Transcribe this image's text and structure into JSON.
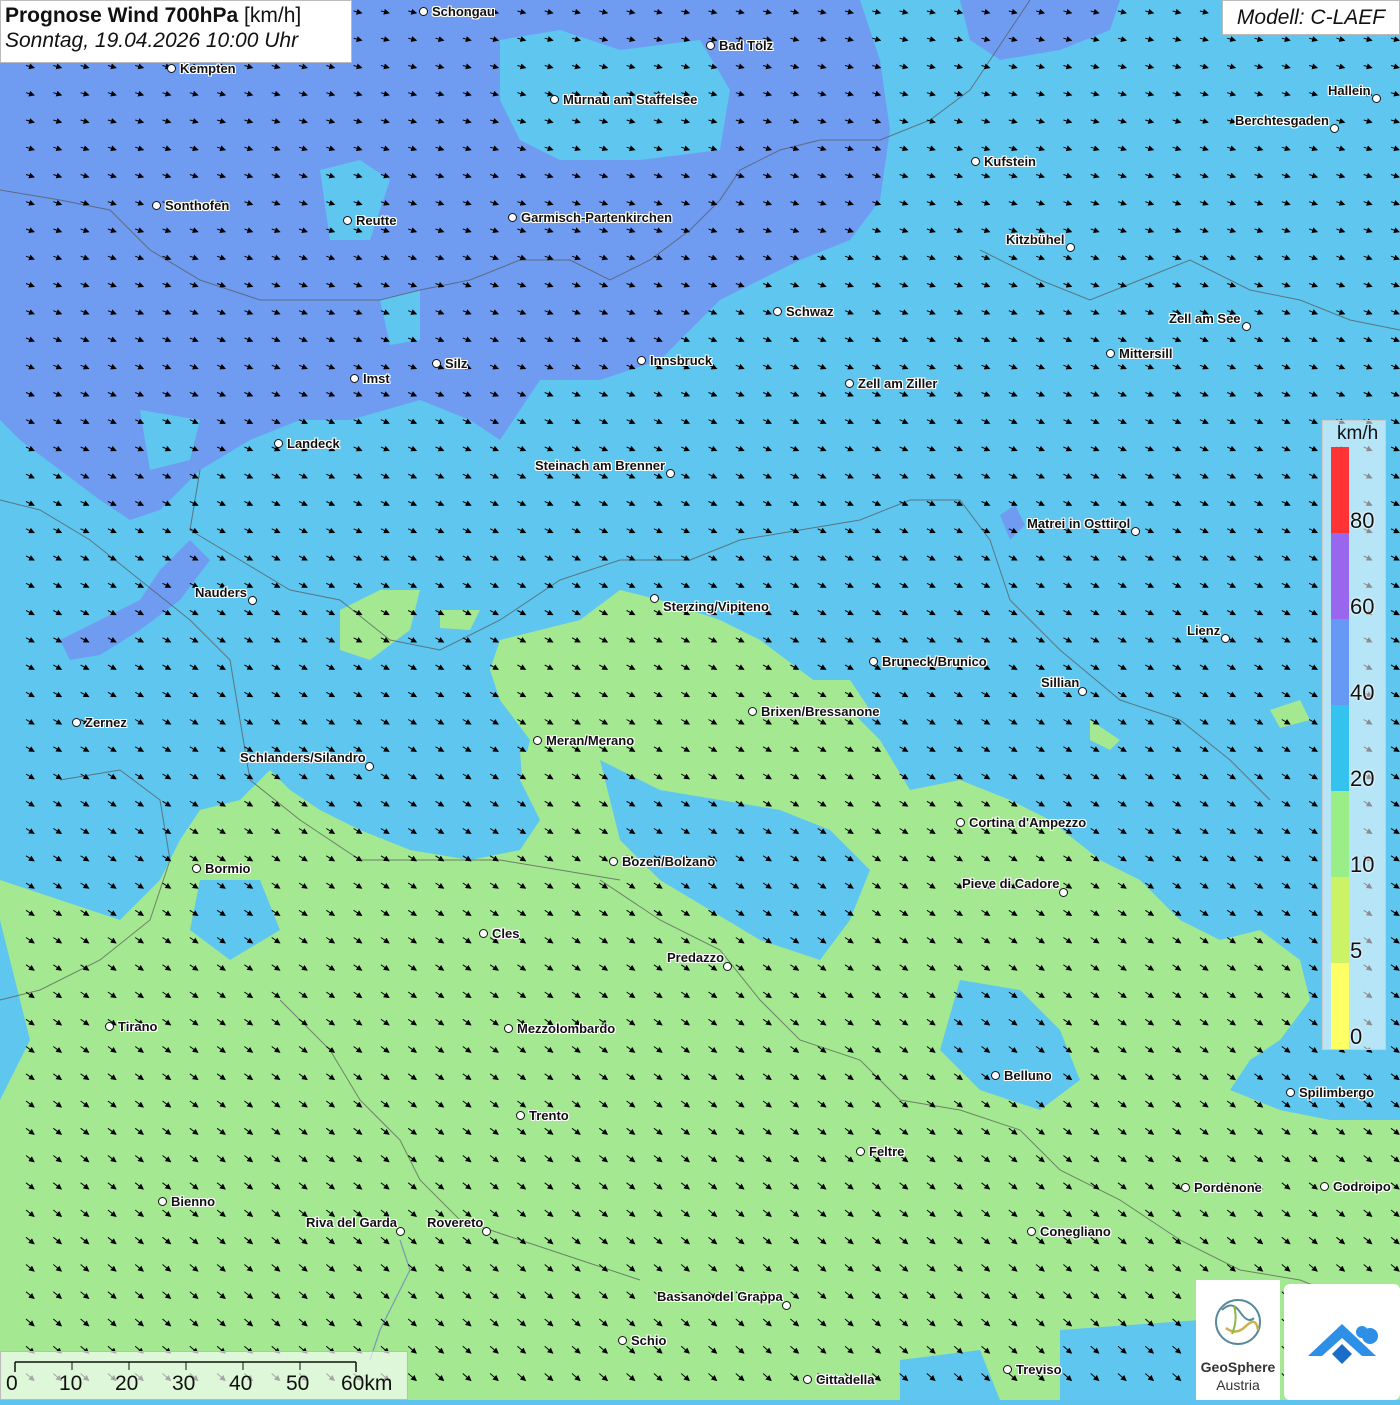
{
  "header": {
    "title_bold": "Prognose Wind 700hPa",
    "title_unit": " [km/h]",
    "datetime": "Sonntag, 19.04.2026 10:00 Uhr",
    "model": "Modell: C-LAEF"
  },
  "legend": {
    "unit": "km/h",
    "stops": [
      {
        "label": "0",
        "color": "#ffff66"
      },
      {
        "label": "5",
        "color": "#ccf266"
      },
      {
        "label": "10",
        "color": "#99ee88"
      },
      {
        "label": "20",
        "color": "#33c3ee"
      },
      {
        "label": "40",
        "color": "#6699f5"
      },
      {
        "label": "60",
        "color": "#9966ee"
      },
      {
        "label": "80",
        "color": "#ff3333"
      }
    ]
  },
  "wind_field": {
    "colors": {
      "calm": "#a4e992",
      "moderate": "#5ec6ef",
      "fresh": "#6f9cf1",
      "strong": "#7e7ef0"
    },
    "predominant_direction": "northwest"
  },
  "scale_bar": {
    "labels": [
      "0",
      "10",
      "20",
      "30",
      "40",
      "50",
      "60km"
    ]
  },
  "cities": [
    {
      "name": "Schongau"
    },
    {
      "name": "Bad Tölz"
    },
    {
      "name": "Kempten"
    },
    {
      "name": "Murnau am Staffelsee"
    },
    {
      "name": "Hallein"
    },
    {
      "name": "Berchtesgaden"
    },
    {
      "name": "Kufstein"
    },
    {
      "name": "Sonthofen"
    },
    {
      "name": "Reutte"
    },
    {
      "name": "Garmisch-Partenkirchen"
    },
    {
      "name": "Kitzbühel"
    },
    {
      "name": "Schwaz"
    },
    {
      "name": "Zell am See"
    },
    {
      "name": "Mittersill"
    },
    {
      "name": "Innsbruck"
    },
    {
      "name": "Silz"
    },
    {
      "name": "Imst"
    },
    {
      "name": "Zell am Ziller"
    },
    {
      "name": "Landeck"
    },
    {
      "name": "Steinach am Brenner"
    },
    {
      "name": "Matrei in Osttirol"
    },
    {
      "name": "Nauders"
    },
    {
      "name": "Sterzing/Vipiteno"
    },
    {
      "name": "Lienz"
    },
    {
      "name": "Bruneck/Brunico"
    },
    {
      "name": "Sillian"
    },
    {
      "name": "Brixen/Bressanone"
    },
    {
      "name": "Zernez"
    },
    {
      "name": "Meran/Merano"
    },
    {
      "name": "Schlanders/Silandro"
    },
    {
      "name": "Cortina d'Ampezzo"
    },
    {
      "name": "Bormio"
    },
    {
      "name": "Bozen/Bolzano"
    },
    {
      "name": "Pieve di Cadore"
    },
    {
      "name": "Cles"
    },
    {
      "name": "Predazzo"
    },
    {
      "name": "Tirano"
    },
    {
      "name": "Mezzolombardo"
    },
    {
      "name": "Belluno"
    },
    {
      "name": "Spilimbergo"
    },
    {
      "name": "Trento"
    },
    {
      "name": "Feltre"
    },
    {
      "name": "Pordenone"
    },
    {
      "name": "Codroipo"
    },
    {
      "name": "Bienno"
    },
    {
      "name": "Riva del Garda"
    },
    {
      "name": "Rovereto"
    },
    {
      "name": "Conegliano"
    },
    {
      "name": "Bassano del Grappa"
    },
    {
      "name": "Schio"
    },
    {
      "name": "Treviso"
    },
    {
      "name": "Cittadella"
    }
  ],
  "logos": {
    "geosphere_name": "GeoSphere",
    "geosphere_sub": "Austria"
  }
}
